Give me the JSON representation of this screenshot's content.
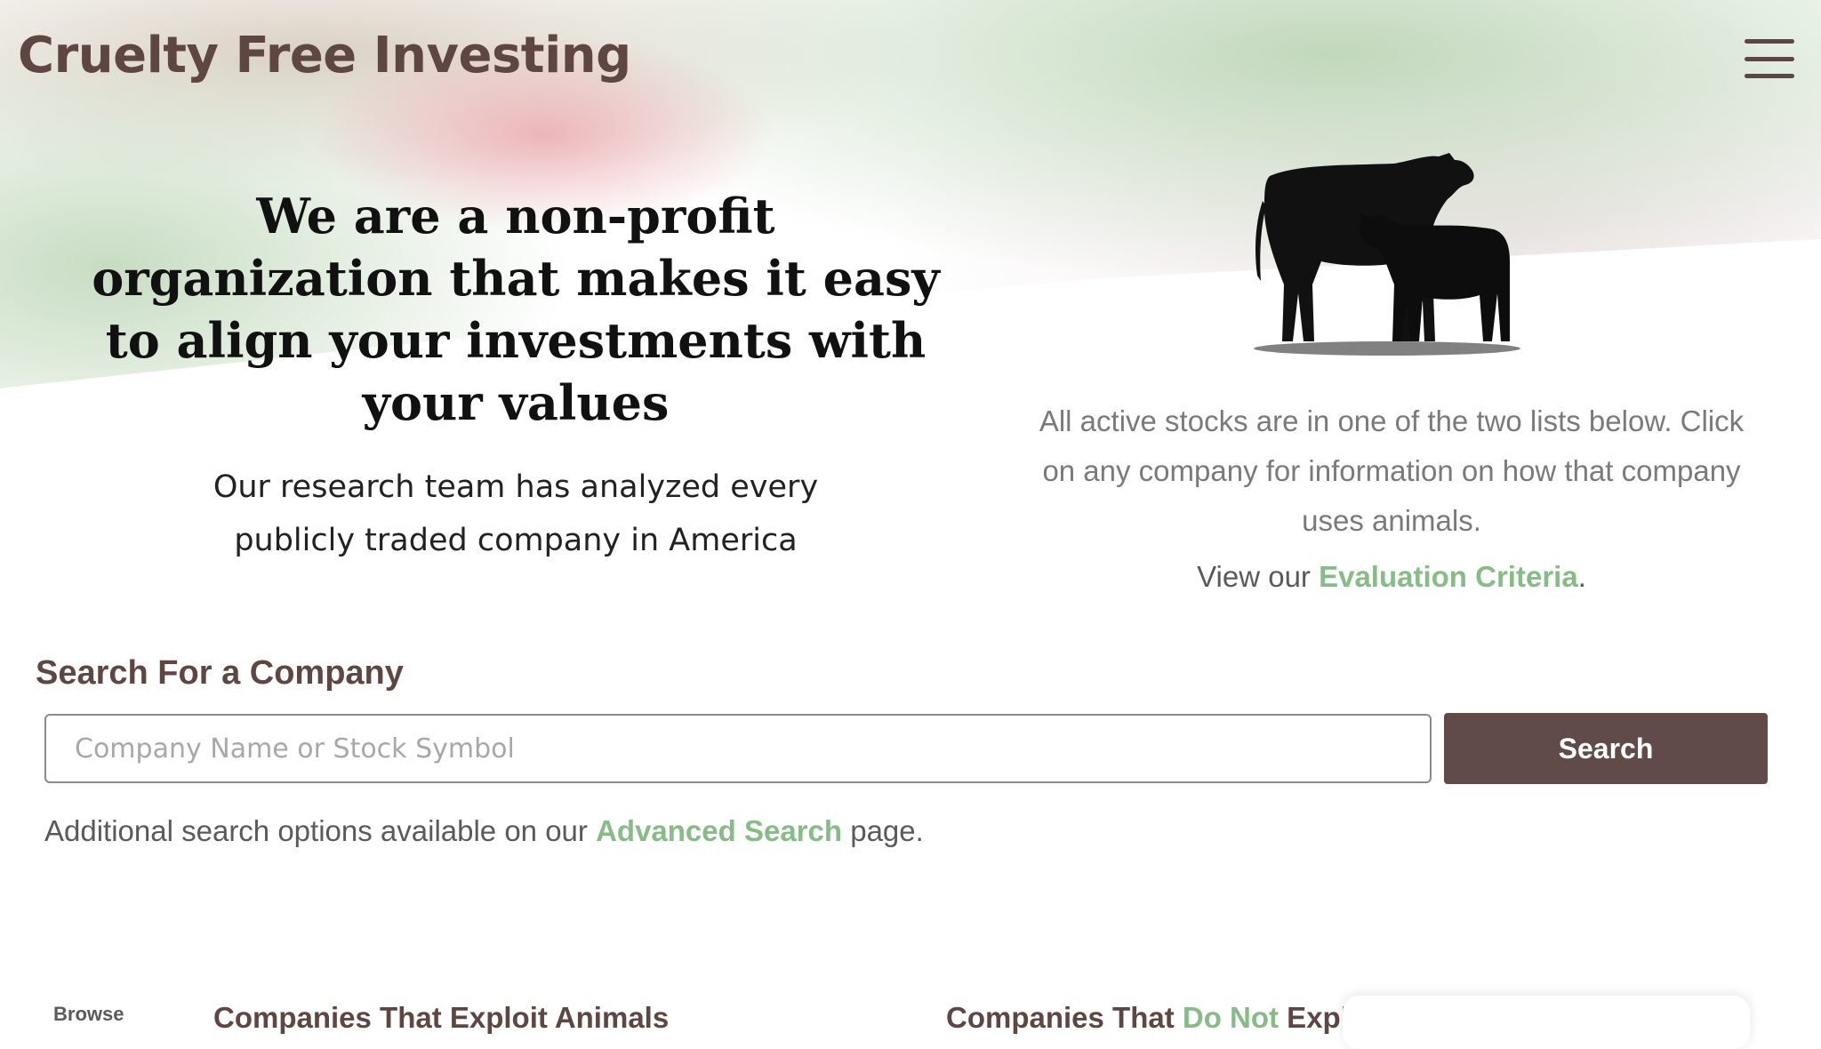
{
  "header": {
    "site_title": "Cruelty Free Investing",
    "menu_icon": "hamburger-menu-icon"
  },
  "hero": {
    "heading": "We are a non-profit organization that makes it easy to align your investments with your values",
    "subheading": "Our research team has analyzed every publicly traded company in America",
    "image_icon": "cow-and-calf-silhouette"
  },
  "lists_info": {
    "text": "All active stocks are in one of the two lists below. Click on any company for information on how that company uses animals.",
    "criteria_prefix": "View our ",
    "criteria_link": "Evaluation Criteria",
    "criteria_suffix": "."
  },
  "search": {
    "title": "Search For a Company",
    "placeholder": "Company Name or Stock Symbol",
    "value": "",
    "button_label": "Search",
    "advanced_prefix": "Additional search options available on our ",
    "advanced_link": "Advanced Search",
    "advanced_suffix": " page."
  },
  "browse": {
    "label": "Browse",
    "exploit_heading": "Companies That Exploit Animals",
    "not_exploit_prefix": "Companies That ",
    "not_exploit_highlight": "Do Not",
    "not_exploit_suffix": " Exploi"
  },
  "colors": {
    "brand_brown": "#5e4642",
    "button_brown": "#614b48",
    "link_green": "#86bc86",
    "muted_text": "#7a7a7a"
  }
}
